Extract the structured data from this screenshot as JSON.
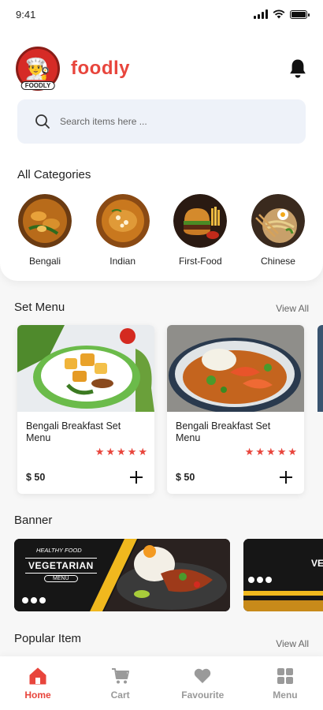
{
  "status_bar": {
    "time": "9:41"
  },
  "app": {
    "brand_name": "foodly",
    "logo_text": "FOODLY"
  },
  "search": {
    "placeholder": "Search items here ..."
  },
  "categories": {
    "title": "All Categories",
    "items": [
      {
        "label": "Bengali"
      },
      {
        "label": "Indian"
      },
      {
        "label": "First-Food"
      },
      {
        "label": "Chinese"
      }
    ]
  },
  "set_menu": {
    "title": "Set Menu",
    "view_all": "View All",
    "cards": [
      {
        "name": "Bengali Breakfast Set Menu",
        "price": "$ 50",
        "rating": 5
      },
      {
        "name": "Bengali Breakfast Set Menu",
        "price": "$ 50",
        "rating": 5
      }
    ]
  },
  "banner": {
    "title": "Banner",
    "items": [
      {
        "tagline": "Healthy Food",
        "heading": "Vegetarian",
        "cta": "Menu"
      },
      {
        "heading": "Ve"
      }
    ]
  },
  "popular": {
    "title": "Popular Item",
    "view_all": "View All"
  },
  "bottom_nav": {
    "items": [
      {
        "label": "Home",
        "icon": "home-icon",
        "active": true
      },
      {
        "label": "Cart",
        "icon": "cart-icon",
        "active": false
      },
      {
        "label": "Favourite",
        "icon": "heart-icon",
        "active": false
      },
      {
        "label": "Menu",
        "icon": "grid-icon",
        "active": false
      }
    ]
  },
  "colors": {
    "accent": "#e8453c",
    "search_bg": "#eef2f9",
    "background": "#f7f7f7"
  }
}
